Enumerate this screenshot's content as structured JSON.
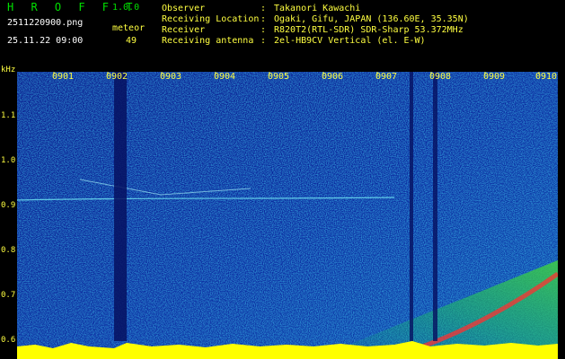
{
  "header": {
    "app_title": "H R O F F T",
    "version": "1.0.0",
    "filename": "2511220900.png",
    "datetime": "25.11.22 09:00",
    "meteor_label": "meteor",
    "meteor_count": "49",
    "rows": [
      {
        "label": "Observer",
        "value": "Takanori Kawachi"
      },
      {
        "label": "Receiving Location",
        "value": "Ogaki, Gifu, JAPAN (136.60E, 35.35N)"
      },
      {
        "label": "Receiver",
        "value": "R820T2(RTL-SDR) SDR-Sharp 53.372MHz"
      },
      {
        "label": "Receiving antenna",
        "value": "2el-HB9CV Vertical (el. E-W)"
      }
    ],
    "separator": ":"
  },
  "axis": {
    "unit": "kHz",
    "y_ticks": [
      "1.1",
      "1.0",
      "0.9",
      "0.8",
      "0.7",
      "0.6"
    ],
    "x_ticks": [
      "0901",
      "0902",
      "0903",
      "0904",
      "0905",
      "0906",
      "0907",
      "0908",
      "0909",
      "0910"
    ]
  },
  "colors": {
    "background": "#000000",
    "label_green": "#00e000",
    "label_yellow": "#ffff40",
    "spectrum_low": "#0a1a8c",
    "spectrum_mid": "#00c8c8",
    "spectrum_high": "#ff2020",
    "noise_floor": "#ffff00"
  }
}
